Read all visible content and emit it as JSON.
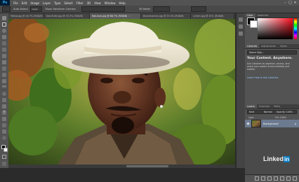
{
  "menubar": {
    "logo": "Ps",
    "items": [
      "File",
      "Edit",
      "Image",
      "Layer",
      "Type",
      "Select",
      "Filter",
      "3D",
      "View",
      "Window",
      "Help"
    ],
    "controls": [
      "–",
      "□",
      "✕"
    ]
  },
  "options": {
    "texts": [
      "Auto-Select:",
      "Layer",
      "Show Transform Controls",
      "3D Mode:"
    ]
  },
  "tabs": [
    {
      "label": "Yellow.jpg @ 16.7% (RGB/8)",
      "active": false
    },
    {
      "label": "Sea-Turtle.jpg @ 33.3% (RGB/8)",
      "active": false
    },
    {
      "label": "Hat-man.jpg @ 66.7% (RGB/8)",
      "active": true
    },
    {
      "label": "Businessman.jpg @ 33.3% (RGB/8)",
      "active": false
    },
    {
      "label": "Lichen.jpg @ 25% (RGB/8)",
      "active": false
    }
  ],
  "color_panel": {
    "tabs": [
      "Color",
      "Swatches"
    ],
    "foreground": "#000000",
    "background": "#ffffff"
  },
  "libraries": {
    "tabs": [
      "Libraries",
      "Adjustments",
      "Styles"
    ],
    "select": "Space Sign...",
    "title": "Your Content. Anywhere.",
    "body": "Use Libraries to organize, access, and share your assets across desktop and mobile.",
    "link": "Learn How to Use Libraries"
  },
  "layers": {
    "tabs": [
      "Layers",
      "Channels",
      "Paths"
    ],
    "kind_filter": "Kind",
    "blend_mode": "Normal",
    "opacity_label": "Opacity: 100%",
    "lock_label": "Lock:",
    "fill_label": "Fill: 100%",
    "layer_name": "Background"
  },
  "watermark": {
    "prefix": "Linked",
    "suffix": "in"
  },
  "icons": [
    "close-icon",
    "eye-icon",
    "lock-icon",
    "move-tool-icon",
    "marquee-tool-icon",
    "lasso-tool-icon",
    "brush-tool-icon",
    "crop-tool-icon"
  ]
}
